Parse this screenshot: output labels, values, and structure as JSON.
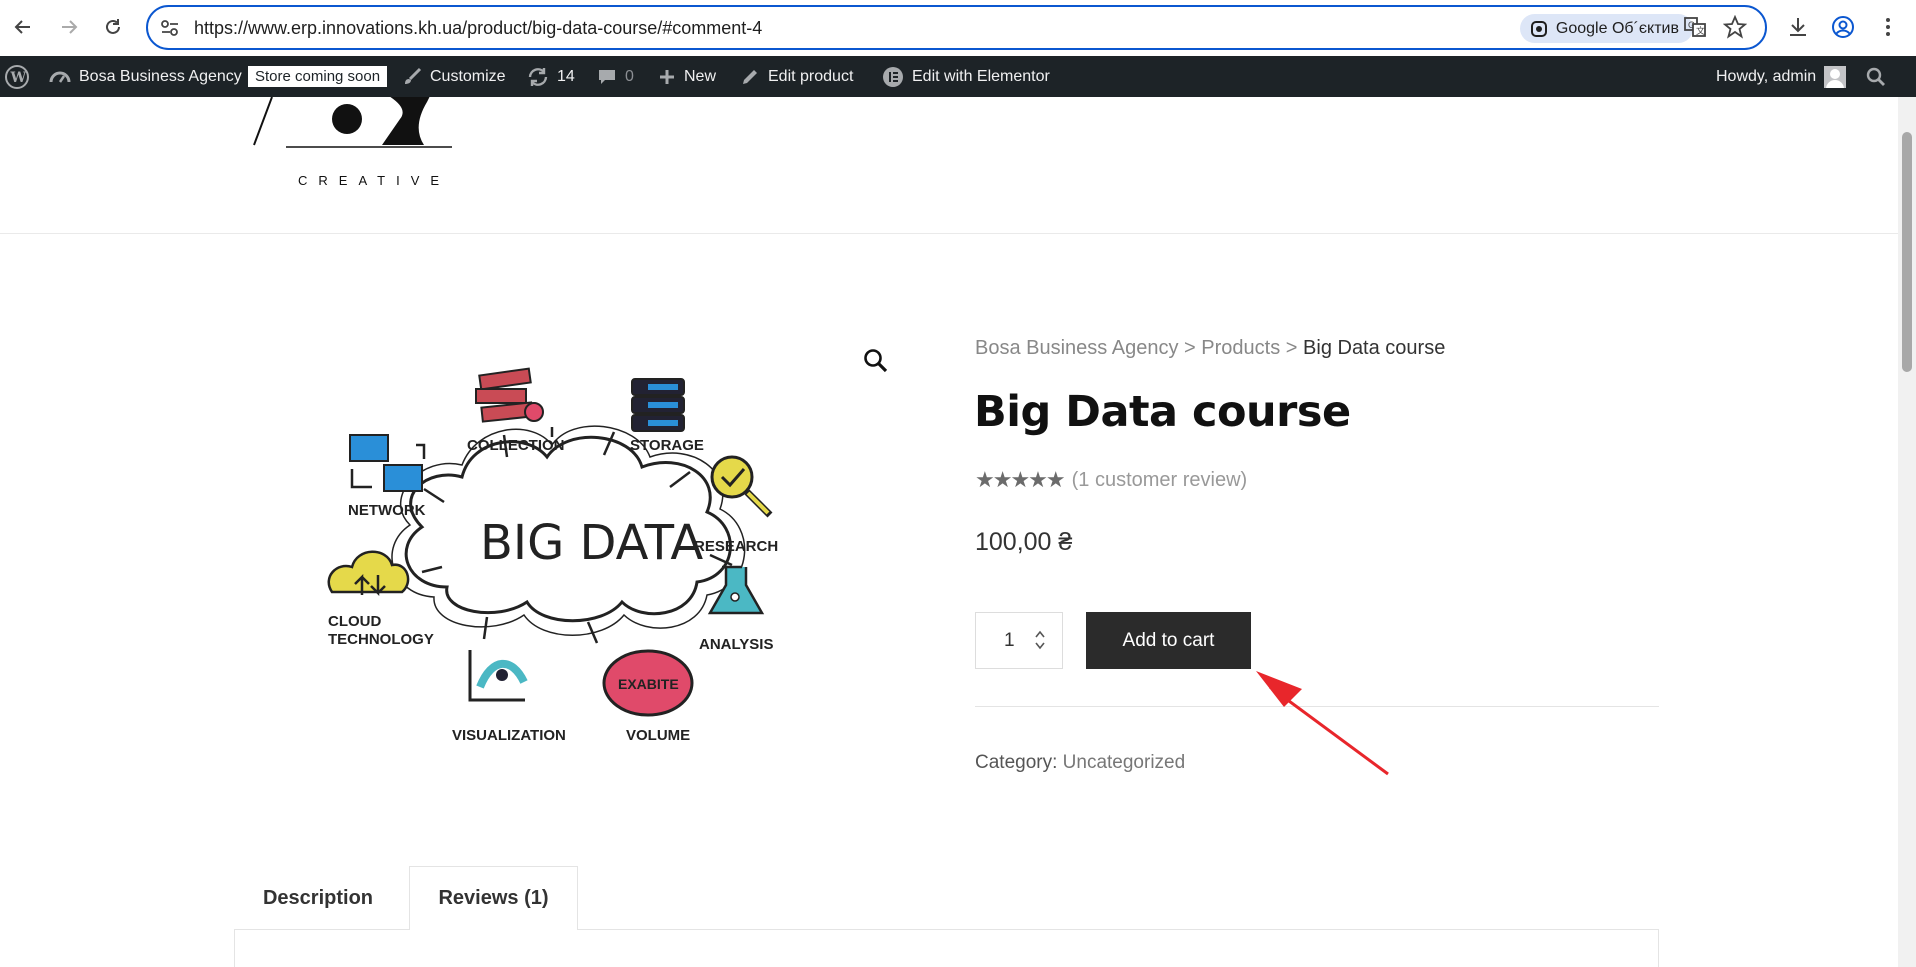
{
  "browser": {
    "url": "https://www.erp.innovations.kh.ua/product/big-data-course/#comment-4",
    "lens_label": "Google Об´єктив"
  },
  "admin_bar": {
    "site_name": "Bosa Business Agency",
    "store_badge": "Store coming soon",
    "customize": "Customize",
    "updates_count": "14",
    "comments_count": "0",
    "new_label": "New",
    "edit_product": "Edit product",
    "edit_elementor": "Edit with Elementor",
    "howdy": "Howdy, admin"
  },
  "header": {
    "logo_text": "CREATIVE"
  },
  "product": {
    "image_labels": {
      "center": "BIG DATA",
      "collection": "COLLECTION",
      "storage": "STORAGE",
      "network": "NETWORK",
      "research": "RESEARCH",
      "cloud_line1": "CLOUD",
      "cloud_line2": "TECHNOLOGY",
      "analysis": "ANALYSIS",
      "visualization": "VISUALIZATION",
      "volume": "VOLUME",
      "exabite": "EXABITE"
    },
    "breadcrumb": {
      "home": "Bosa Business Agency",
      "sep1": ">",
      "products": "Products",
      "sep2": ">",
      "current": "Big Data course"
    },
    "title": "Big Data course",
    "rating_stars": "★★★★★",
    "rating_value": 5,
    "review_link": "(1 customer review)",
    "price": "100,00 ₴",
    "quantity": "1",
    "add_to_cart": "Add to cart",
    "category_label": "Category:",
    "category_value": "Uncategorized"
  },
  "tabs": [
    {
      "label": "Description",
      "active": false
    },
    {
      "label": "Reviews (1)",
      "active": true
    }
  ],
  "colors": {
    "accent_blue": "#0b57d0",
    "admin_bar": "#1d2327",
    "button": "#2b2b2b",
    "annotation_arrow": "#e8262b"
  }
}
